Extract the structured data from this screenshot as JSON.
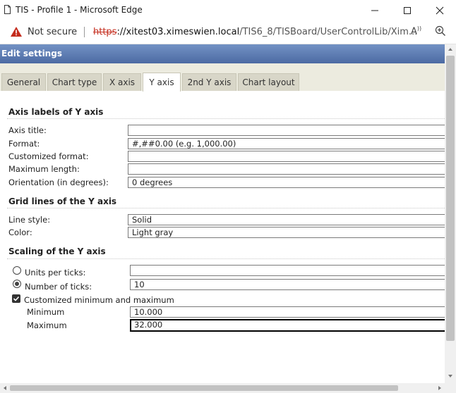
{
  "window": {
    "title": "TIS - Profile 1 - Microsoft Edge"
  },
  "address_bar": {
    "security_text": "Not secure",
    "url_scheme": "https",
    "url_host": "://xitest03.ximeswien.local",
    "url_path": "/TIS6_8/TISBoard/UserControlLib/Xim...",
    "read_aloud_label": "A"
  },
  "dialog": {
    "title": "Edit settings",
    "tabs": [
      {
        "label": "General"
      },
      {
        "label": "Chart type"
      },
      {
        "label": "X axis"
      },
      {
        "label": "Y axis",
        "active": true
      },
      {
        "label": "2nd Y axis"
      },
      {
        "label": "Chart layout"
      }
    ]
  },
  "axis_labels": {
    "section_title": "Axis labels of Y axis",
    "axis_title_label": "Axis title:",
    "axis_title_value": "",
    "format_label": "Format:",
    "format_value": "#,##0.00 (e.g. 1,000.00)",
    "custom_format_label": "Customized format:",
    "custom_format_value": "",
    "max_length_label": "Maximum length:",
    "max_length_value": "",
    "orientation_label": "Orientation (in degrees):",
    "orientation_value": "0 degrees"
  },
  "grid_lines": {
    "section_title": "Grid lines of the Y axis",
    "line_style_label": "Line style:",
    "line_style_value": "Solid",
    "color_label": "Color:",
    "color_value": "Light gray"
  },
  "scaling": {
    "section_title": "Scaling of the Y axis",
    "units_per_ticks_label": "Units per ticks:",
    "units_per_ticks_value": "",
    "units_per_ticks_selected": false,
    "number_of_ticks_label": "Number of ticks:",
    "number_of_ticks_value": "10",
    "number_of_ticks_selected": true,
    "custom_minmax_label": "Customized minimum and maximum",
    "custom_minmax_checked": true,
    "minimum_label": "Minimum",
    "minimum_value": "10.000",
    "maximum_label": "Maximum",
    "maximum_value": "32.000"
  },
  "colors": {
    "header_start": "#7392c4",
    "header_end": "#4c6aa3",
    "tab_strip": "#ecebdf",
    "tab_inactive": "#d8d6c8",
    "url_scheme_red": "#c42b1c",
    "warning_red": "#c42b1c"
  },
  "icons": {
    "page": "page-icon",
    "minimize": "minimize-icon",
    "maximize": "maximize-icon",
    "close": "close-icon",
    "warning": "warning-icon",
    "read_aloud": "read-aloud-icon",
    "zoom": "zoom-icon"
  }
}
